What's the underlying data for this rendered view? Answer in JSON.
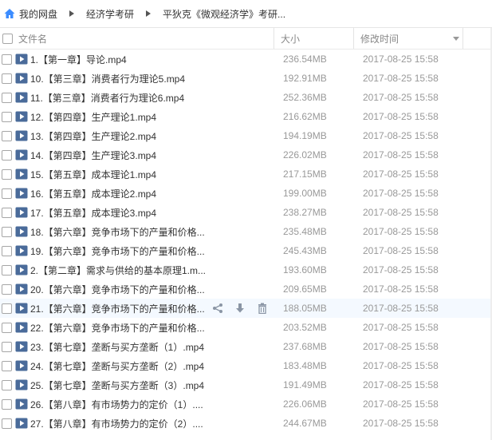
{
  "breadcrumb": [
    "我的网盘",
    "经济学考研",
    "平狄克《微观经济学》考研..."
  ],
  "columns": {
    "name": "文件名",
    "size": "大小",
    "date": "修改时间"
  },
  "files": [
    {
      "name": "1.【第一章】导论.mp4",
      "size": "236.54MB",
      "date": "2017-08-25 15:58"
    },
    {
      "name": "10.【第三章】消费者行为理论5.mp4",
      "size": "192.91MB",
      "date": "2017-08-25 15:58"
    },
    {
      "name": "11.【第三章】消费者行为理论6.mp4",
      "size": "252.36MB",
      "date": "2017-08-25 15:58"
    },
    {
      "name": "12.【第四章】生产理论1.mp4",
      "size": "216.62MB",
      "date": "2017-08-25 15:58"
    },
    {
      "name": "13.【第四章】生产理论2.mp4",
      "size": "194.19MB",
      "date": "2017-08-25 15:58"
    },
    {
      "name": "14.【第四章】生产理论3.mp4",
      "size": "226.02MB",
      "date": "2017-08-25 15:58"
    },
    {
      "name": "15.【第五章】成本理论1.mp4",
      "size": "217.15MB",
      "date": "2017-08-25 15:58"
    },
    {
      "name": "16.【第五章】成本理论2.mp4",
      "size": "199.00MB",
      "date": "2017-08-25 15:58"
    },
    {
      "name": "17.【第五章】成本理论3.mp4",
      "size": "238.27MB",
      "date": "2017-08-25 15:58"
    },
    {
      "name": "18.【第六章】竞争市场下的产量和价格...",
      "size": "235.48MB",
      "date": "2017-08-25 15:58"
    },
    {
      "name": "19.【第六章】竞争市场下的产量和价格...",
      "size": "245.43MB",
      "date": "2017-08-25 15:58"
    },
    {
      "name": "2.【第二章】需求与供给的基本原理1.m...",
      "size": "193.60MB",
      "date": "2017-08-25 15:58"
    },
    {
      "name": "20.【第六章】竞争市场下的产量和价格...",
      "size": "209.65MB",
      "date": "2017-08-25 15:58"
    },
    {
      "name": "21.【第六章】竞争市场下的产量和价格...",
      "size": "188.05MB",
      "date": "2017-08-25 15:58"
    },
    {
      "name": "22.【第六章】竞争市场下的产量和价格...",
      "size": "203.52MB",
      "date": "2017-08-25 15:58"
    },
    {
      "name": "23.【第七章】垄断与买方垄断（1）.mp4",
      "size": "237.68MB",
      "date": "2017-08-25 15:58"
    },
    {
      "name": "24.【第七章】垄断与买方垄断（2）.mp4",
      "size": "183.48MB",
      "date": "2017-08-25 15:58"
    },
    {
      "name": "25.【第七章】垄断与买方垄断（3）.mp4",
      "size": "191.49MB",
      "date": "2017-08-25 15:58"
    },
    {
      "name": "26.【第八章】有市场势力的定价（1）....",
      "size": "226.06MB",
      "date": "2017-08-25 15:58"
    },
    {
      "name": "27.【第八章】有市场势力的定价（2）....",
      "size": "244.67MB",
      "date": "2017-08-25 15:58"
    }
  ],
  "hover_row_index": 13,
  "hover_actions": [
    "share-icon",
    "download-icon",
    "delete-icon"
  ],
  "colors": {
    "accent": "#3b8cff",
    "video_icon": "#4a6b9a",
    "row_hover": "#f4f9ff"
  }
}
